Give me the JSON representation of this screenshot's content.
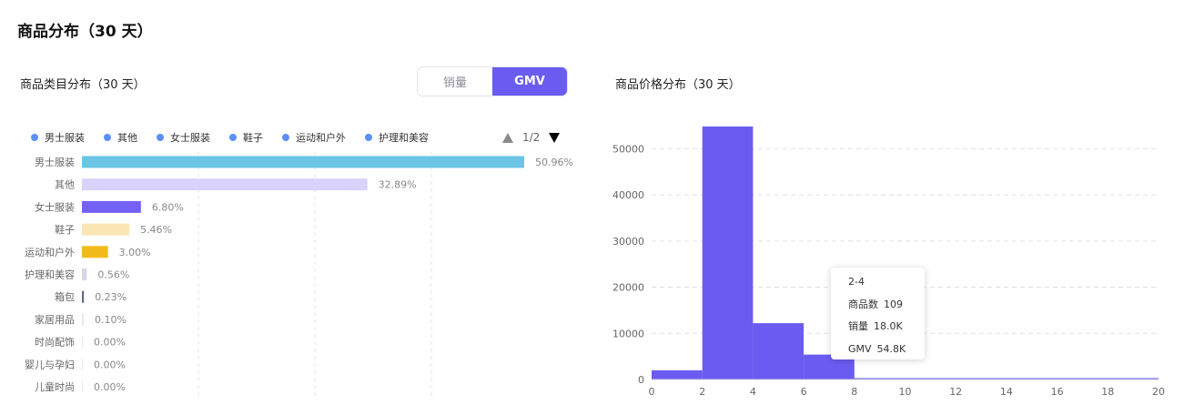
{
  "page": {
    "title": "商品分布（30 天）"
  },
  "category_panel": {
    "title": "商品类目分布（30 天）",
    "toggle": {
      "option1": "销量",
      "option2": "GMV",
      "selected": "GMV"
    },
    "legend_page": "1/2"
  },
  "price_panel": {
    "title": "商品价格分布（30 天）"
  },
  "tooltip": {
    "title": "2-4",
    "rows": [
      {
        "key": "商品数",
        "value": "109"
      },
      {
        "key": "销量",
        "value": "18.0K"
      },
      {
        "key": "GMV",
        "value": "54.8K"
      }
    ]
  },
  "colors": {
    "accent": "#6a5cf0",
    "legend_dot": "#5b8ff9"
  },
  "chart_data": [
    {
      "type": "bar",
      "orientation": "horizontal",
      "legend": [
        "男士服装",
        "其他",
        "女士服装",
        "鞋子",
        "运动和户外",
        "护理和美容"
      ],
      "categories": [
        "男士服装",
        "其他",
        "女士服装",
        "鞋子",
        "运动和户外",
        "护理和美容",
        "箱包",
        "家居用品",
        "时尚配饰",
        "婴儿与孕妇",
        "儿童时尚"
      ],
      "values": [
        50.96,
        32.89,
        6.8,
        5.46,
        3.0,
        0.56,
        0.23,
        0.1,
        0.0,
        0.0,
        0.0
      ],
      "labels": [
        "50.96%",
        "32.89%",
        "6.80%",
        "5.46%",
        "3.00%",
        "0.56%",
        "0.23%",
        "0.10%",
        "0.00%",
        "0.00%",
        "0.00%"
      ],
      "bar_colors": [
        "#6bc6e6",
        "#d9d3fb",
        "#7361f6",
        "#fbe6b3",
        "#f2bb1b",
        "#d8d7e7",
        "#5f6b85",
        "#e8e8ee",
        "#e8e8ee",
        "#e8e8ee",
        "#e8e8ee"
      ],
      "xlim": [
        0,
        50.96
      ]
    },
    {
      "type": "bar",
      "subtype": "histogram",
      "bins": [
        [
          0,
          2
        ],
        [
          2,
          4
        ],
        [
          4,
          6
        ],
        [
          6,
          8
        ],
        [
          8,
          20
        ]
      ],
      "values": [
        2000,
        54800,
        12200,
        5400,
        300
      ],
      "x_ticks": [
        0,
        2,
        4,
        6,
        8,
        10,
        12,
        14,
        16,
        18,
        20
      ],
      "y_ticks": [
        0,
        10000,
        20000,
        30000,
        40000,
        50000
      ],
      "xlim": [
        0,
        20
      ],
      "ylim": [
        0,
        55000
      ],
      "color": "#6a5cf0"
    }
  ]
}
